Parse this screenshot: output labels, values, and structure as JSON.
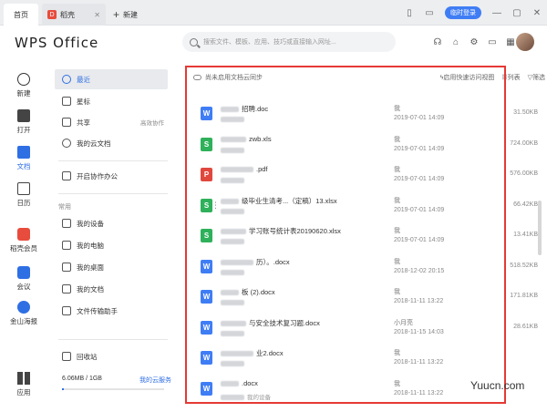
{
  "titlebar": {
    "tab_home": "首页",
    "tab_doc": "稻壳",
    "tab_new": "新建",
    "login": "临时登录"
  },
  "header": {
    "brand": "WPS Office",
    "search_placeholder": "搜索文件、模板、应用、技巧或直接输入网址..."
  },
  "rail": [
    {
      "label": "新建",
      "icon": "plus-icon"
    },
    {
      "label": "打开",
      "icon": "folder-icon"
    },
    {
      "label": "文档",
      "icon": "document-icon"
    },
    {
      "label": "日历",
      "icon": "calendar-icon"
    },
    {
      "label": "稻壳会员",
      "icon": "docer-icon"
    },
    {
      "label": "会议",
      "icon": "meeting-icon"
    },
    {
      "label": "金山海报",
      "icon": "poster-icon"
    },
    {
      "label": "应用",
      "icon": "apps-icon"
    }
  ],
  "sidebar": {
    "items": [
      {
        "label": "最近",
        "extra": ""
      },
      {
        "label": "星标",
        "extra": ""
      },
      {
        "label": "共享",
        "extra": "高效协作"
      },
      {
        "label": "我的云文档",
        "extra": ""
      },
      {
        "label": "开启协作办公",
        "extra": ""
      }
    ],
    "common_label": "常用",
    "common": [
      {
        "label": "我的设备"
      },
      {
        "label": "我的电脑"
      },
      {
        "label": "我的桌面"
      },
      {
        "label": "我的文档"
      },
      {
        "label": "文件传输助手"
      }
    ],
    "recycle": "回收站",
    "storage": "6.06MB / 1GB",
    "storage_link": "我的云服务",
    "storage_fraction": 0.006
  },
  "toolbar": {
    "sync": "尚未启用文档云同步",
    "quick_view": "启用快速访问视图",
    "list": "列表",
    "filter": "筛选"
  },
  "files": [
    {
      "type": "w",
      "name": "招聘.doc",
      "owner": "我",
      "date": "2019-07-01 14:09",
      "size": "31.50KB",
      "sub": ""
    },
    {
      "type": "s",
      "name": "zwb.xls",
      "owner": "我",
      "date": "2019-07-01 14:09",
      "size": "724.00KB",
      "sub": ""
    },
    {
      "type": "p",
      "name": ".pdf",
      "owner": "我",
      "date": "2019-07-01 14:09",
      "size": "576.00KB",
      "sub": ""
    },
    {
      "type": "s",
      "name": "级毕业生清考...（定稿）13.xlsx",
      "owner": "我",
      "date": "2019-07-01 14:09",
      "size": "66.42KB",
      "sub": ""
    },
    {
      "type": "s",
      "name": "学习账号统计表20190620.xlsx",
      "owner": "我",
      "date": "2019-07-01 14:09",
      "size": "13.41KB",
      "sub": ""
    },
    {
      "type": "w",
      "name": "历）。.docx",
      "owner": "我",
      "date": "2018-12-02 20:15",
      "size": "518.52KB",
      "sub": ""
    },
    {
      "type": "w",
      "name": "板 (2).docx",
      "owner": "我",
      "date": "2018-11-11 13:22",
      "size": "171.81KB",
      "sub": ""
    },
    {
      "type": "w",
      "name": "与安全技术复习题.docx",
      "owner": "小月亮",
      "date": "2018-11-15 14:03",
      "size": "28.61KB",
      "sub": ""
    },
    {
      "type": "w",
      "name": "业2.docx",
      "owner": "我",
      "date": "2018-11-11 13:22",
      "size": "",
      "sub": ""
    },
    {
      "type": "w",
      "name": ".docx",
      "owner": "我",
      "date": "2018-11-11 13:22",
      "size": "",
      "sub": "我的设备"
    }
  ],
  "watermark": "Yuucn.com"
}
